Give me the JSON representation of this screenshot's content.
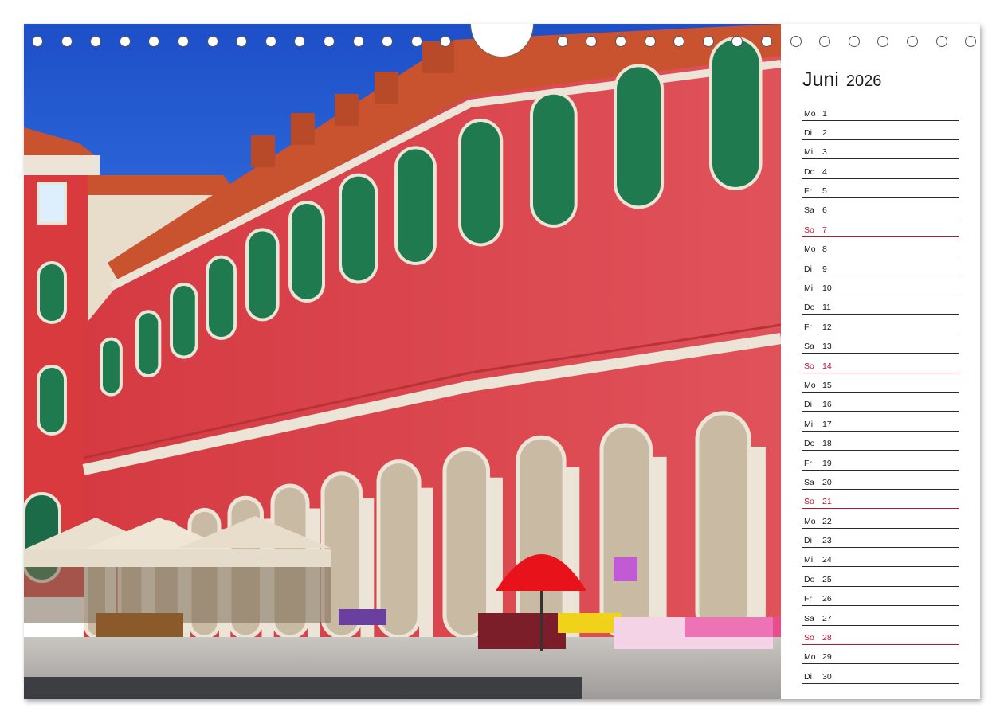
{
  "calendar": {
    "month": "Juni",
    "year": "2026",
    "sunday_color": "#c8102e",
    "days": [
      {
        "weekday": "Mo",
        "day": "1",
        "sunday": false
      },
      {
        "weekday": "Di",
        "day": "2",
        "sunday": false
      },
      {
        "weekday": "Mi",
        "day": "3",
        "sunday": false
      },
      {
        "weekday": "Do",
        "day": "4",
        "sunday": false
      },
      {
        "weekday": "Fr",
        "day": "5",
        "sunday": false
      },
      {
        "weekday": "Sa",
        "day": "6",
        "sunday": false
      },
      {
        "weekday": "So",
        "day": "7",
        "sunday": true
      },
      {
        "weekday": "Mo",
        "day": "8",
        "sunday": false
      },
      {
        "weekday": "Di",
        "day": "9",
        "sunday": false
      },
      {
        "weekday": "Mi",
        "day": "10",
        "sunday": false
      },
      {
        "weekday": "Do",
        "day": "11",
        "sunday": false
      },
      {
        "weekday": "Fr",
        "day": "12",
        "sunday": false
      },
      {
        "weekday": "Sa",
        "day": "13",
        "sunday": false
      },
      {
        "weekday": "So",
        "day": "14",
        "sunday": true
      },
      {
        "weekday": "Mo",
        "day": "15",
        "sunday": false
      },
      {
        "weekday": "Di",
        "day": "16",
        "sunday": false
      },
      {
        "weekday": "Mi",
        "day": "17",
        "sunday": false
      },
      {
        "weekday": "Do",
        "day": "18",
        "sunday": false
      },
      {
        "weekday": "Fr",
        "day": "19",
        "sunday": false
      },
      {
        "weekday": "Sa",
        "day": "20",
        "sunday": false
      },
      {
        "weekday": "So",
        "day": "21",
        "sunday": true
      },
      {
        "weekday": "Mo",
        "day": "22",
        "sunday": false
      },
      {
        "weekday": "Di",
        "day": "23",
        "sunday": false
      },
      {
        "weekday": "Mi",
        "day": "24",
        "sunday": false
      },
      {
        "weekday": "Do",
        "day": "25",
        "sunday": false
      },
      {
        "weekday": "Fr",
        "day": "26",
        "sunday": false
      },
      {
        "weekday": "Sa",
        "day": "27",
        "sunday": false
      },
      {
        "weekday": "So",
        "day": "28",
        "sunday": true
      },
      {
        "weekday": "Mo",
        "day": "29",
        "sunday": false
      },
      {
        "weekday": "Di",
        "day": "30",
        "sunday": false
      }
    ]
  },
  "photo": {
    "sky_color": "#1f5fd6",
    "facade_color": "#d8434b",
    "roof_color": "#c9532f",
    "shutter_color": "#1f7a4f",
    "stone_color": "#ece4d6",
    "umbrella_color": "#e8131a"
  }
}
